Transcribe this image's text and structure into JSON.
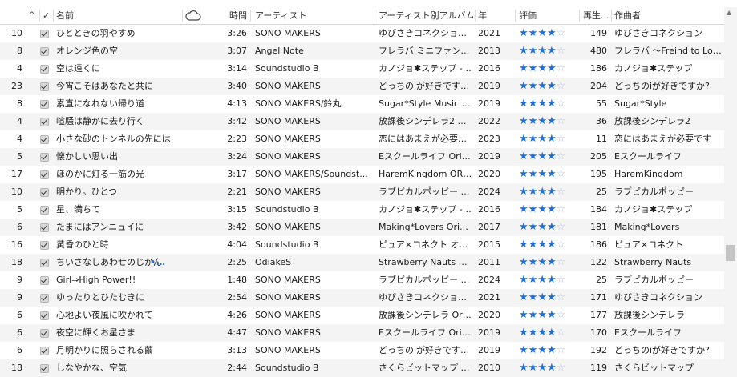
{
  "header": {
    "sort_indicator": "^",
    "check": "✓",
    "name": "名前",
    "time": "時間",
    "artist": "アーティスト",
    "album_artist": "アーティスト別アルバム",
    "year": "年",
    "rating": "評価",
    "plays": "再生...",
    "composer": "作曲者"
  },
  "icons": {
    "cloud": "cloud-icon",
    "more": "more-icon",
    "sort": "sort-up-icon",
    "check": "checkbox-icon"
  },
  "colors": {
    "accent": "#1f6fd6",
    "row_alt": "#f4f4f4"
  },
  "rows": [
    {
      "track": "10",
      "name": "ひとときの羽やすめ",
      "time": "3:26",
      "artist": "SONO MAKERS",
      "album": "ゆぴさきコネクション O...",
      "year": "2021",
      "stars": 4,
      "plays": "149",
      "composer": "ゆびさきコネクション"
    },
    {
      "track": "8",
      "name": "オレンジ色の空",
      "time": "3:07",
      "artist": "Angel Note",
      "album": "フレラバ ミニファンディス...",
      "year": "2013",
      "stars": 4,
      "plays": "480",
      "composer": "フレラバ 〜Freind to Lov..."
    },
    {
      "track": "4",
      "name": "空は遠くに",
      "time": "3:14",
      "artist": "Soundstudio B",
      "album": "カノジョ✱ステップ -ORI...",
      "year": "2016",
      "stars": 4,
      "plays": "186",
      "composer": "カノジョ✱ステップ"
    },
    {
      "track": "23",
      "name": "今宵こそはあなたと共に",
      "time": "3:40",
      "artist": "SONO MAKERS",
      "album": "どっちのiが好きですか?...",
      "year": "2019",
      "stars": 4,
      "plays": "204",
      "composer": "どっちのiが好きですか?"
    },
    {
      "track": "8",
      "name": "素直になれない帰り道",
      "time": "4:13",
      "artist": "SONO MAKERS/鈴丸",
      "album": "Sugar*Style Music a...",
      "year": "2019",
      "stars": 4,
      "plays": "55",
      "composer": "Sugar*Style"
    },
    {
      "track": "4",
      "name": "喧騒は静かに去り行く",
      "time": "3:42",
      "artist": "SONO MAKERS",
      "album": "放課後シンデレラ2 Ori...",
      "year": "2022",
      "stars": 4,
      "plays": "36",
      "composer": "放課後シンデレラ2"
    },
    {
      "track": "4",
      "name": "小さな砂のトンネルの先には",
      "time": "2:23",
      "artist": "SONO MAKERS",
      "album": "恋にはあまえが必要です...",
      "year": "2023",
      "stars": 4,
      "plays": "11",
      "composer": "恋にはあまえが必要です"
    },
    {
      "track": "5",
      "name": "懐かしい思い出",
      "time": "3:24",
      "artist": "SONO MAKERS",
      "album": "Eスクールライフ Origin...",
      "year": "2019",
      "stars": 4,
      "plays": "205",
      "composer": "Eスクールライフ"
    },
    {
      "track": "17",
      "name": "ほのかに灯る一筋の光",
      "time": "3:17",
      "artist": "SONO MAKERS/Soundst...",
      "album": "HaremKingdom ORI...",
      "year": "2020",
      "stars": 4,
      "plays": "195",
      "composer": "HaremKingdom"
    },
    {
      "track": "10",
      "name": "明かり。ひとつ",
      "time": "2:21",
      "artist": "SONO MAKERS",
      "album": "ラブピカルポッピー ORI...",
      "year": "2024",
      "stars": 4,
      "plays": "25",
      "composer": "ラブピカルポッピー"
    },
    {
      "track": "5",
      "name": "星、満ちて",
      "time": "3:15",
      "artist": "Soundstudio B",
      "album": "カノジョ✱ステップ -ORI...",
      "year": "2016",
      "stars": 4,
      "plays": "184",
      "composer": "カノジョ✱ステップ"
    },
    {
      "track": "6",
      "name": "たまにはアンニュイに",
      "time": "3:42",
      "artist": "SONO MAKERS",
      "album": "Making*Lovers Origi...",
      "year": "2017",
      "stars": 4,
      "plays": "181",
      "composer": "Making*Lovers"
    },
    {
      "track": "16",
      "name": "黄昏のひと時",
      "time": "4:04",
      "artist": "Soundstudio B",
      "album": "ピュア×コネクト オリ...",
      "year": "2015",
      "stars": 4,
      "plays": "186",
      "composer": "ピュア×コネクト"
    },
    {
      "track": "18",
      "name": "ちいさなしあわせのじかん",
      "time": "2:25",
      "artist": "OdiakeS",
      "album": "Strawberry Nauts O...",
      "year": "2011",
      "stars": 4,
      "plays": "122",
      "composer": "Strawberry Nauts",
      "more": "•••"
    },
    {
      "track": "9",
      "name": "Girl⇒High Power!!",
      "time": "1:48",
      "artist": "SONO MAKERS",
      "album": "ラブピカルポッピー ORI...",
      "year": "2024",
      "stars": 4,
      "plays": "25",
      "composer": "ラブピカルポッピー"
    },
    {
      "track": "9",
      "name": "ゆったりとひたむきに",
      "time": "2:54",
      "artist": "SONO MAKERS",
      "album": "ゆびさきコネクション O...",
      "year": "2021",
      "stars": 4,
      "plays": "171",
      "composer": "ゆびさきコネクション"
    },
    {
      "track": "6",
      "name": "心地よい夜風に吹かれて",
      "time": "4:26",
      "artist": "SONO MAKERS",
      "album": "放課後シンデレラ Ori...",
      "year": "2020",
      "stars": 4,
      "plays": "177",
      "composer": "放課後シンデレラ"
    },
    {
      "track": "6",
      "name": "夜空に輝くお星さま",
      "time": "4:47",
      "artist": "SONO MAKERS",
      "album": "Eスクールライフ Origin...",
      "year": "2019",
      "stars": 4,
      "plays": "170",
      "composer": "Eスクールライフ"
    },
    {
      "track": "6",
      "name": "月明かりに照らされる繭",
      "time": "3:13",
      "artist": "SONO MAKERS",
      "album": "どっちのiが好きですか?...",
      "year": "2019",
      "stars": 4,
      "plays": "192",
      "composer": "どっちのiが好きですか?"
    },
    {
      "track": "18",
      "name": "しなやかな、空気",
      "time": "2:44",
      "artist": "Soundstudio B",
      "album": "さくらビットマップ オリジ...",
      "year": "2010",
      "stars": 4,
      "plays": "119",
      "composer": "さくらビットマップ"
    }
  ]
}
